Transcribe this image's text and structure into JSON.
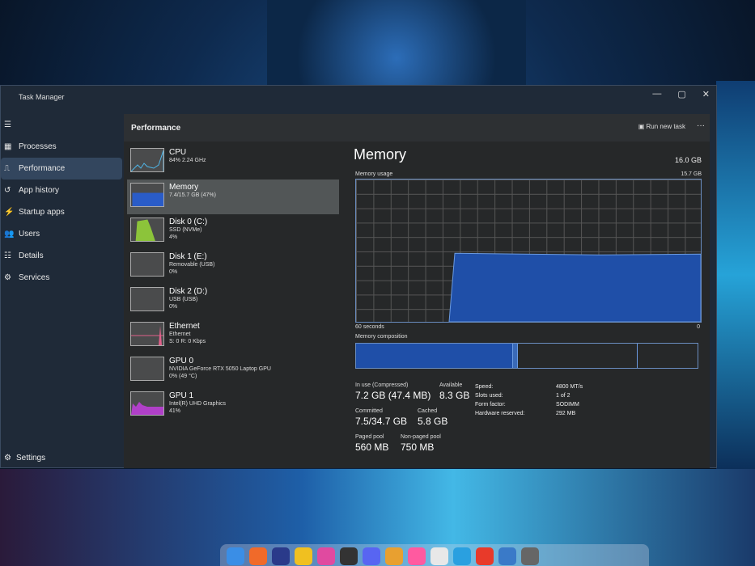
{
  "window": {
    "title": "Task Manager",
    "controls": [
      "—",
      "▢",
      "✕"
    ]
  },
  "sidebar": {
    "items": [
      {
        "icon": "☰",
        "label": ""
      },
      {
        "icon": "▦",
        "label": "Processes"
      },
      {
        "icon": "⎍",
        "label": "Performance"
      },
      {
        "icon": "↺",
        "label": "App history"
      },
      {
        "icon": "⚡",
        "label": "Startup apps"
      },
      {
        "icon": "👥",
        "label": "Users"
      },
      {
        "icon": "☷",
        "label": "Details"
      },
      {
        "icon": "⚙",
        "label": "Services"
      }
    ],
    "settings": "Settings"
  },
  "panel": {
    "title": "Performance",
    "run_new_task": "Run new task",
    "more": "···"
  },
  "devices": [
    {
      "name": "CPU",
      "l2": "84% 2.24 GHz",
      "l3": "",
      "color": "#4fb6e8"
    },
    {
      "name": "Memory",
      "l2": "7.4/15.7 GB (47%)",
      "l3": "",
      "color": "#2a5cc8"
    },
    {
      "name": "Disk 0 (C:)",
      "l2": "SSD (NVMe)",
      "l3": "4%",
      "color": "#8cc43a"
    },
    {
      "name": "Disk 1 (E:)",
      "l2": "Removable (USB)",
      "l3": "0%",
      "color": ""
    },
    {
      "name": "Disk 2 (D:)",
      "l2": "USB (USB)",
      "l3": "0%",
      "color": ""
    },
    {
      "name": "Ethernet",
      "l2": "Ethernet",
      "l3": "S: 0 R: 0 Kbps",
      "color": "#e0608a"
    },
    {
      "name": "GPU 0",
      "l2": "NVIDIA GeForce RTX 5050 Laptop GPU",
      "l3": "0% (49 °C)",
      "color": ""
    },
    {
      "name": "GPU 1",
      "l2": "Intel(R) UHD Graphics",
      "l3": "41%",
      "color": "#b040c8"
    }
  ],
  "memory": {
    "title": "Memory",
    "total": "16.0 GB",
    "usage_label": "Memory usage",
    "usage_max": "15.7 GB",
    "time_label": "60 seconds",
    "time_end": "0",
    "composition_label": "Memory composition",
    "usage_percent": 47,
    "stats": {
      "in_use_label": "In use (Compressed)",
      "in_use": "7.2 GB (47.4 MB)",
      "available_label": "Available",
      "available": "8.3 GB",
      "committed_label": "Committed",
      "committed": "7.5/34.7 GB",
      "cached_label": "Cached",
      "cached": "5.8 GB",
      "paged_label": "Paged pool",
      "paged": "560 MB",
      "nonpaged_label": "Non-paged pool",
      "nonpaged": "750 MB"
    },
    "hw": [
      {
        "k": "Speed:",
        "v": "4800 MT/s"
      },
      {
        "k": "Slots used:",
        "v": "1 of 2"
      },
      {
        "k": "Form factor:",
        "v": "SODIMM"
      },
      {
        "k": "Hardware reserved:",
        "v": "292 MB"
      }
    ]
  },
  "dock_colors": [
    "#3a8ee6",
    "#f06a2a",
    "#2a3a8a",
    "#f0c020",
    "#e04aa0",
    "#333",
    "#5865f2",
    "#e8a030",
    "#ff5aa0",
    "#e8e8e8",
    "#2aa0e0",
    "#e83a2a",
    "#3a7ac8",
    "#666"
  ]
}
